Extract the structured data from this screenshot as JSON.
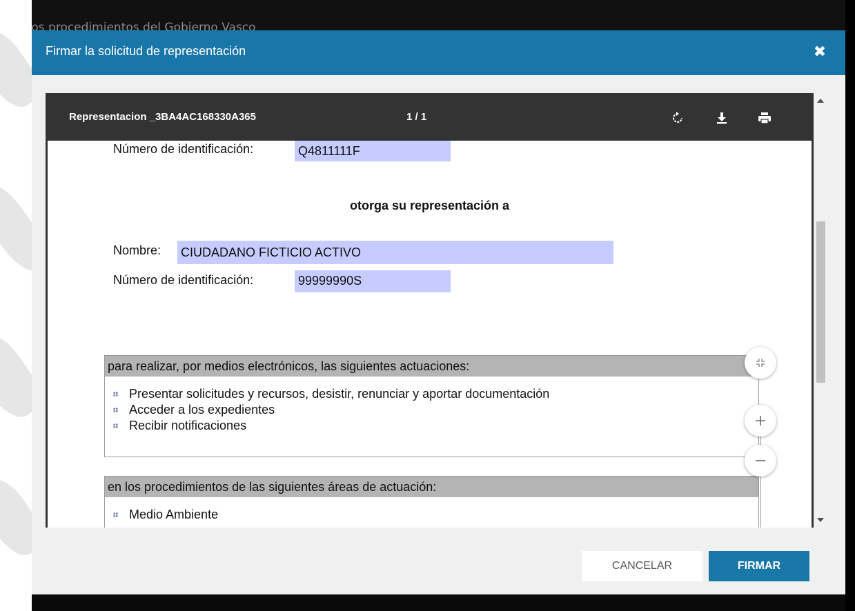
{
  "background": {
    "text": "os los procedimientos del Gobierno Vasco"
  },
  "modal": {
    "title": "Firmar la solicitud de representación",
    "close_icon": "close-icon"
  },
  "viewer": {
    "document_name": "Representacion _3BA4AC168330A365",
    "page_indicator": "1 / 1",
    "icons": [
      "rotate-icon",
      "download-icon",
      "print-icon"
    ]
  },
  "document": {
    "id_label_1": "Número de identificación:",
    "id_value_1": "Q4811111F",
    "grant_heading": "otorga su representación a",
    "name_label": "Nombre:",
    "name_value": "CIUDADANO  FICTICIO  ACTIVO",
    "id_label_2": "Número de identificación:",
    "id_value_2": "99999990S",
    "actions_header": "para realizar, por medios electrónicos, las siguientes actuaciones:",
    "actions": [
      "Presentar solicitudes y recursos, desistir, renunciar y aportar documentación",
      "Acceder a los expedientes",
      "Recibir notificaciones"
    ],
    "areas_header": "en los procedimientos de las siguientes áreas de actuación:",
    "areas": [
      "Medio Ambiente"
    ]
  },
  "zoom": {
    "icons": [
      "fit-page-icon",
      "zoom-in-icon",
      "zoom-out-icon"
    ]
  },
  "footer": {
    "cancel_label": "CANCELAR",
    "sign_label": "FIRMAR"
  },
  "colors": {
    "header": "#1976a8",
    "field_highlight": "#c6ccff",
    "sign_button": "#1a78a8"
  }
}
